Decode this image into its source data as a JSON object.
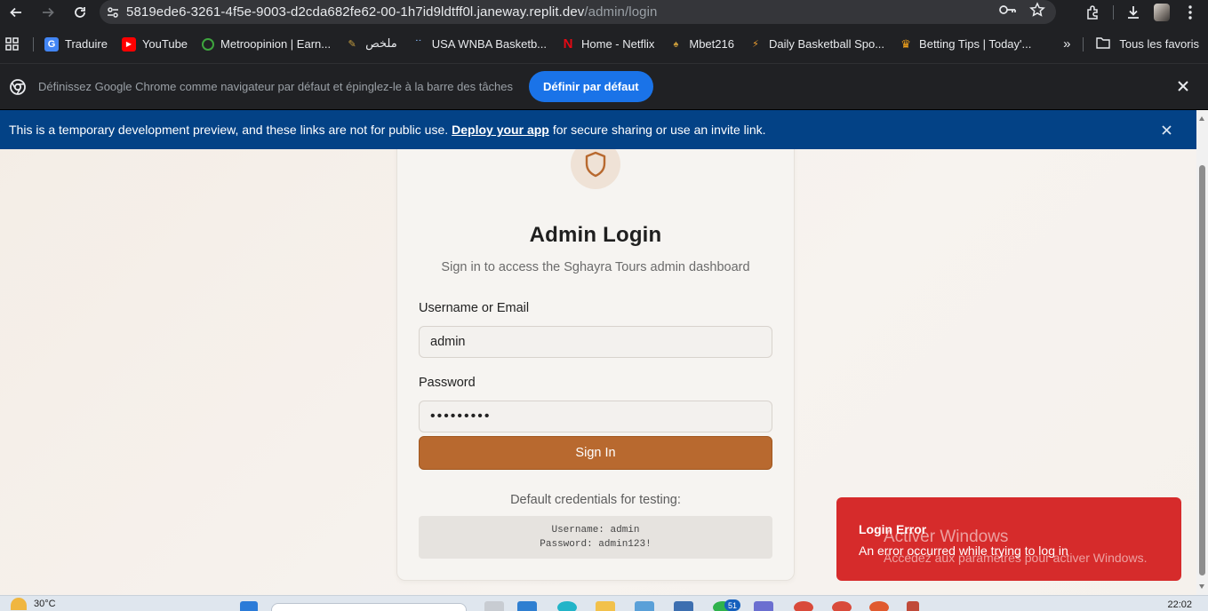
{
  "browser": {
    "url_host": "5819ede6-3261-4f5e-9003-d2cda682fe62-00-1h7id9ldtff0l.janeway.replit.dev",
    "url_path": "/admin/login",
    "bookmarks": [
      {
        "label": "Traduire",
        "icon": "google-translate-icon",
        "color": "#4285f4"
      },
      {
        "label": "YouTube",
        "icon": "youtube-icon",
        "color": "#ff0000"
      },
      {
        "label": "Metroopinion | Earn...",
        "icon": "metroopinion-icon",
        "color": "#3ea53e"
      },
      {
        "label": "ملخص",
        "icon": "bookmark-icon",
        "color": "#c8a040"
      },
      {
        "label": "USA WNBA Basketb...",
        "icon": "bookmark-icon",
        "color": "#7aa7e0"
      },
      {
        "label": "Home - Netflix",
        "icon": "netflix-icon",
        "color": "#e50914"
      },
      {
        "label": "Mbet216",
        "icon": "bookmark-icon",
        "color": "#c79a3a"
      },
      {
        "label": "Daily Basketball Spo...",
        "icon": "basketball-icon",
        "color": "#f0a030"
      },
      {
        "label": "Betting Tips | Today'...",
        "icon": "crown-icon",
        "color": "#f2a21b"
      }
    ],
    "all_bookmarks_label": "Tous les favoris",
    "infobar_text": "Définissez Google Chrome comme navigateur par défaut et épinglez-le à la barre des tâches",
    "infobar_button": "Définir par défaut"
  },
  "banner": {
    "text_before": "This is a temporary development preview, and these links are not for public use.",
    "link": "Deploy your app",
    "text_after": "for secure sharing or use an invite link."
  },
  "login": {
    "title": "Admin Login",
    "subtitle": "Sign in to access the Sghayra Tours admin dashboard",
    "username_label": "Username or Email",
    "username_value": "admin",
    "password_label": "Password",
    "password_mask": "•••••••••",
    "submit_label": "Sign In",
    "creds_title": "Default credentials for testing:",
    "creds_username": "Username: admin",
    "creds_password": "Password: admin123!"
  },
  "toast": {
    "title": "Login Error",
    "message": "An error occurred while trying to log in"
  },
  "watermark": {
    "line1": "Activer Windows",
    "line2": "Accédez aux paramètres pour activer Windows."
  },
  "taskbar": {
    "temperature": "30°C",
    "badge_count": "51",
    "clock": "22:02"
  },
  "colors": {
    "accent": "#b8692f",
    "banner": "#034286",
    "error": "#d62b2b",
    "chrome_button": "#1a73e8"
  }
}
